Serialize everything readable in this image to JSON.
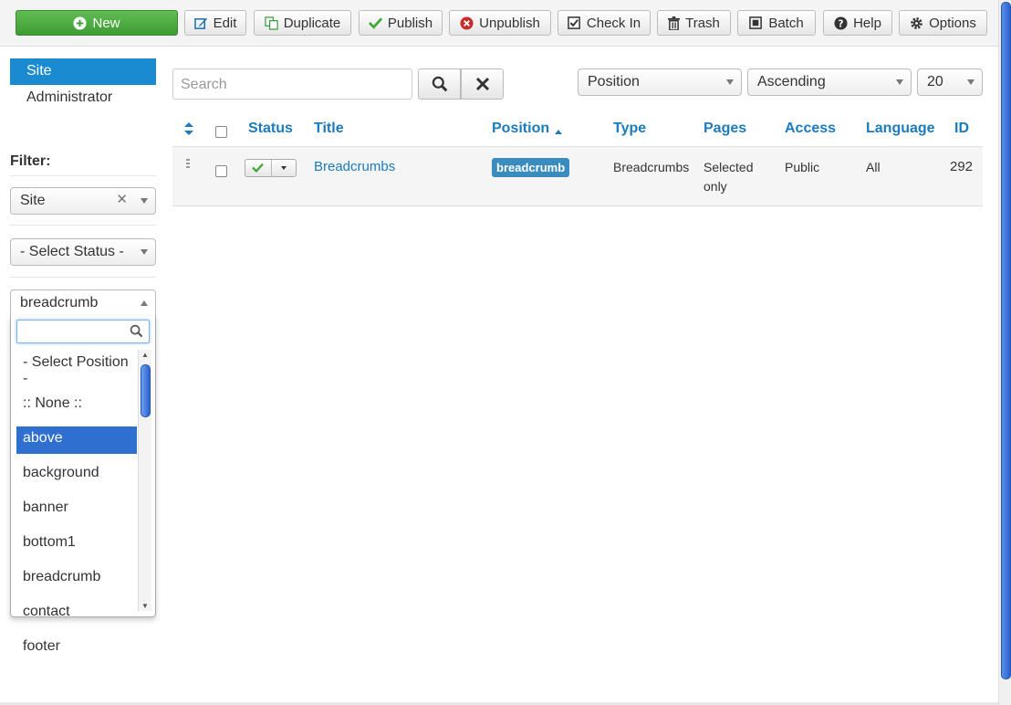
{
  "toolbar": {
    "new": "New",
    "edit": "Edit",
    "duplicate": "Duplicate",
    "publish": "Publish",
    "unpublish": "Unpublish",
    "checkin": "Check In",
    "trash": "Trash",
    "batch": "Batch",
    "help": "Help",
    "options": "Options"
  },
  "sidebar": {
    "site": "Site",
    "administrator": "Administrator",
    "filter_label": "Filter:",
    "client_filter": "Site",
    "status_filter": "- Select Status -",
    "position_filter": "breadcrumb",
    "position_options": [
      "- Select Position -",
      ":: None ::",
      "above",
      "background",
      "banner",
      "bottom1",
      "breadcrumb",
      "contact",
      "footer"
    ],
    "highlighted_option": "above"
  },
  "search": {
    "placeholder": "Search"
  },
  "sorting": {
    "order_by": "Position",
    "direction": "Ascending",
    "limit": "20"
  },
  "table": {
    "headers": {
      "status": "Status",
      "title": "Title",
      "position": "Position",
      "type": "Type",
      "pages": "Pages",
      "access": "Access",
      "language": "Language",
      "id": "ID"
    },
    "rows": [
      {
        "title": "Breadcrumbs",
        "position": "breadcrumb",
        "type": "Breadcrumbs",
        "pages_1": "Selected",
        "pages_2": "only",
        "access": "Public",
        "language": "All",
        "id": "292",
        "published": true
      }
    ]
  },
  "colors": {
    "accent": "#1a8bd0",
    "new_button": "#4cae3f",
    "link": "#1b7bbd",
    "badge": "#3a8cbf",
    "highlight": "#2f6fd0"
  }
}
